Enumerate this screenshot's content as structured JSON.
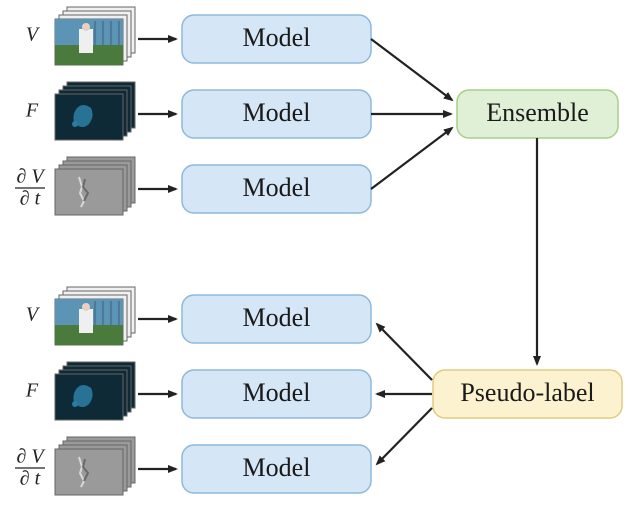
{
  "nodes": {
    "model": "Model",
    "ensemble": "Ensemble",
    "pseudo": "Pseudo-label"
  },
  "inputs": {
    "video": "V",
    "flow": "F",
    "tg_num": "∂ V",
    "tg_den": "∂ t"
  }
}
